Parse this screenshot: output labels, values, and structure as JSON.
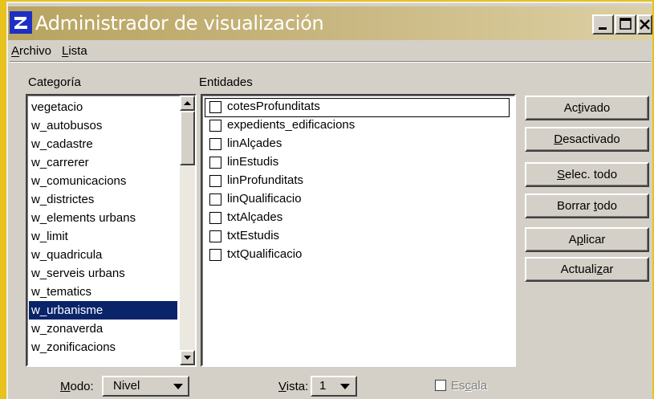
{
  "window": {
    "title": "Administrador de visualización",
    "controls": {
      "minimize": "_",
      "maximize": "□",
      "close": "×"
    }
  },
  "menu": [
    {
      "label": "Archivo",
      "accel": "A"
    },
    {
      "label": "Lista",
      "accel": "L"
    }
  ],
  "categories": {
    "label": "Categoría",
    "items": [
      "vegetacio",
      "w_autobusos",
      "w_cadastre",
      "w_carrerer",
      "w_comunicacions",
      "w_districtes",
      "w_elements urbans",
      "w_limit",
      "w_quadricula",
      "w_serveis urbans",
      "w_tematics",
      "w_urbanisme",
      "w_zonaverda",
      "w_zonificacions"
    ],
    "selected": "w_urbanisme"
  },
  "entities": {
    "label": "Entidades",
    "items": [
      {
        "name": "cotesProfunditats",
        "checked": false
      },
      {
        "name": "expedients_edificacions",
        "checked": false
      },
      {
        "name": "linAlçades",
        "checked": false
      },
      {
        "name": "linEstudis",
        "checked": false
      },
      {
        "name": "linProfunditats",
        "checked": false
      },
      {
        "name": "linQualificacio",
        "checked": false
      },
      {
        "name": "txtAlçades",
        "checked": false
      },
      {
        "name": "txtEstudis",
        "checked": false
      },
      {
        "name": "txtQualificacio",
        "checked": false
      }
    ]
  },
  "buttons": {
    "activado": {
      "pre": "Ac",
      "acc": "t",
      "post": "ivado"
    },
    "desactivado": {
      "pre": "",
      "acc": "D",
      "post": "esactivado"
    },
    "selec_todo": {
      "pre": "",
      "acc": "S",
      "post": "elec. todo"
    },
    "borrar_todo": {
      "pre": "Borrar ",
      "acc": "t",
      "post": "odo"
    },
    "aplicar": {
      "pre": "A",
      "acc": "p",
      "post": "licar"
    },
    "actualizar": {
      "pre": "Actuali",
      "acc": "z",
      "post": "ar"
    }
  },
  "footer": {
    "modo_label": {
      "pre": "",
      "acc": "M",
      "post": "odo:"
    },
    "modo_value": "Nivel",
    "vista_label": {
      "pre": "",
      "acc": "V",
      "post": "ista:"
    },
    "vista_value": "1",
    "escala_label": {
      "pre": "Es",
      "acc": "c",
      "post": "ala"
    },
    "escala_checked": false
  },
  "colors": {
    "desktop": "#e8c21e",
    "titlebar": "#b8a460",
    "selection": "#0a246a",
    "face": "#d4d0c8"
  }
}
